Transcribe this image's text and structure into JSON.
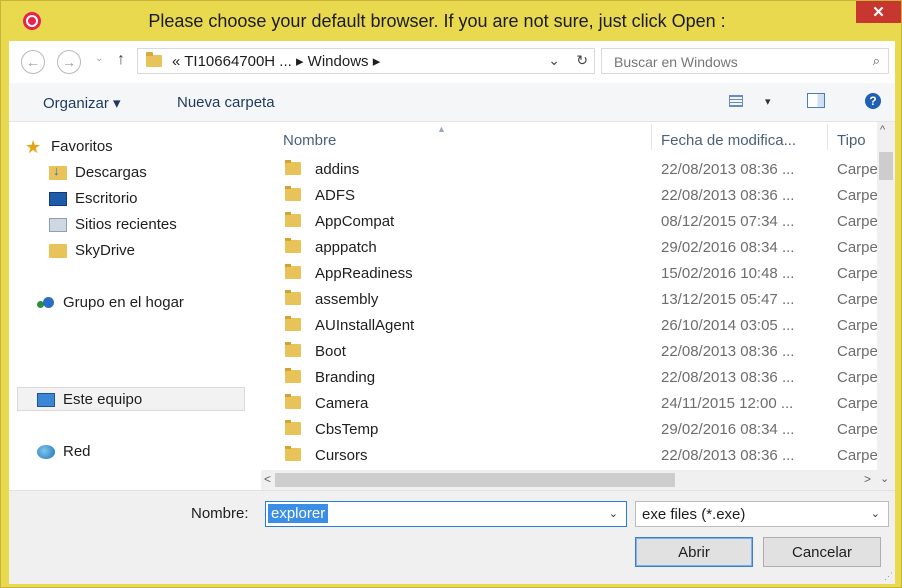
{
  "window": {
    "title": "Please choose your default browser. If you are not sure, just click Open :",
    "close_glyph": "✕"
  },
  "address": {
    "back_glyph": "←",
    "forward_glyph": "→",
    "dropdown_glyph": "⌄",
    "up_glyph": "↑",
    "path": "« TI10664700H ... ▸ Windows ▸",
    "refresh_glyph": "↻",
    "dropdown_tail_glyph": "⌄",
    "search_placeholder": "Buscar en Windows",
    "search_glyph": "⌕"
  },
  "toolbar": {
    "organize_label": "Organizar ▾",
    "new_folder_label": "Nueva carpeta",
    "view_drop_glyph": "▾",
    "help_glyph": "?"
  },
  "nav": {
    "favorites_label": "Favoritos",
    "favorites": [
      {
        "label": "Descargas",
        "icon": "downloads-icon"
      },
      {
        "label": "Escritorio",
        "icon": "desktop-icon"
      },
      {
        "label": "Sitios recientes",
        "icon": "recent-places-icon"
      },
      {
        "label": "SkyDrive",
        "icon": "folder-icon"
      }
    ],
    "homegroup_label": "Grupo en el hogar",
    "this_pc_label": "Este equipo",
    "network_label": "Red"
  },
  "list": {
    "columns": {
      "name": "Nombre",
      "date": "Fecha de modifica...",
      "type": "Tipo"
    },
    "rows": [
      {
        "name": "addins",
        "date": "22/08/2013 08:36 ...",
        "type": "Carpet"
      },
      {
        "name": "ADFS",
        "date": "22/08/2013 08:36 ...",
        "type": "Carpet"
      },
      {
        "name": "AppCompat",
        "date": "08/12/2015 07:34 ...",
        "type": "Carpet"
      },
      {
        "name": "apppatch",
        "date": "29/02/2016 08:34 ...",
        "type": "Carpet"
      },
      {
        "name": "AppReadiness",
        "date": "15/02/2016 10:48 ...",
        "type": "Carpet"
      },
      {
        "name": "assembly",
        "date": "13/12/2015 05:47 ...",
        "type": "Carpet"
      },
      {
        "name": "AUInstallAgent",
        "date": "26/10/2014 03:05 ...",
        "type": "Carpet"
      },
      {
        "name": "Boot",
        "date": "22/08/2013 08:36 ...",
        "type": "Carpet"
      },
      {
        "name": "Branding",
        "date": "22/08/2013 08:36 ...",
        "type": "Carpet"
      },
      {
        "name": "Camera",
        "date": "24/11/2015 12:00 ...",
        "type": "Carpet"
      },
      {
        "name": "CbsTemp",
        "date": "29/02/2016 08:34 ...",
        "type": "Carpet"
      },
      {
        "name": "Cursors",
        "date": "22/08/2013 08:36 ...",
        "type": "Carpet"
      }
    ],
    "scroll_up_glyph": "^",
    "scroll_down_glyph": "⌄",
    "scroll_left_glyph": "<",
    "scroll_right_glyph": ">"
  },
  "footer": {
    "filename_label": "Nombre:",
    "filename_value": "explorer",
    "filename_drop_glyph": "⌄",
    "filetype_value": "exe files (*.exe)",
    "filetype_drop_glyph": "⌄",
    "open_label": "Abrir",
    "cancel_label": "Cancelar",
    "grip_glyph": "⋰"
  },
  "colors": {
    "title_bar": "#e9d94f",
    "close_button": "#c7372f",
    "selection": "#3a8ee6"
  }
}
